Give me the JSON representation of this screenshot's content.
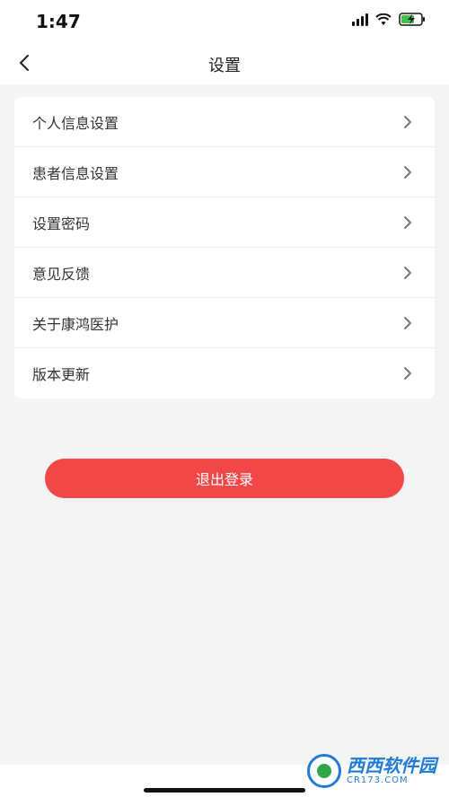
{
  "status_bar": {
    "time": "1:47"
  },
  "nav": {
    "title": "设置"
  },
  "settings": {
    "items": [
      {
        "label": "个人信息设置"
      },
      {
        "label": "患者信息设置"
      },
      {
        "label": "设置密码"
      },
      {
        "label": "意见反馈"
      },
      {
        "label": "关于康鸿医护"
      },
      {
        "label": "版本更新"
      }
    ]
  },
  "logout": {
    "label": "退出登录"
  },
  "watermark": {
    "main": "西西软件园",
    "sub": "CR173.COM"
  },
  "colors": {
    "accent": "#f14747",
    "background": "#f4f4f4"
  }
}
